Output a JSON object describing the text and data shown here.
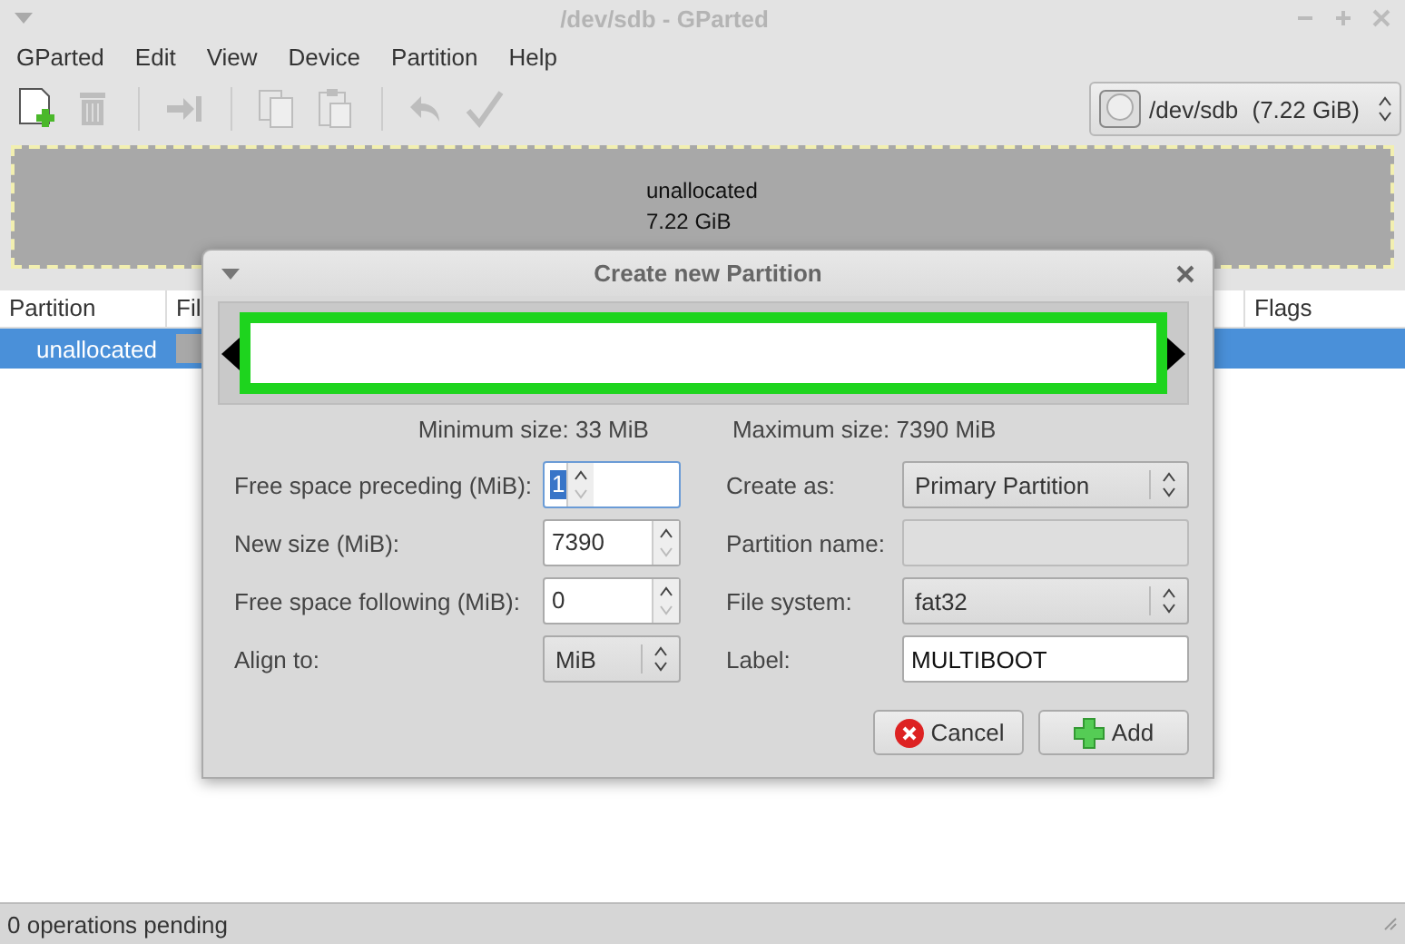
{
  "window": {
    "title": "/dev/sdb - GParted"
  },
  "menu": [
    "GParted",
    "Edit",
    "View",
    "Device",
    "Partition",
    "Help"
  ],
  "toolbar": [
    [
      {
        "kind": "new",
        "disabled": false
      },
      {
        "kind": "delete",
        "disabled": true
      }
    ],
    [
      {
        "kind": "resize",
        "disabled": true
      }
    ],
    [
      {
        "kind": "copy",
        "disabled": true
      },
      {
        "kind": "paste",
        "disabled": true
      }
    ],
    [
      {
        "kind": "undo",
        "disabled": true
      },
      {
        "kind": "apply",
        "disabled": true
      }
    ]
  ],
  "device": {
    "name": "/dev/sdb",
    "size": "(7.22 GiB)"
  },
  "disk_map": {
    "label": "unallocated",
    "size": "7.22 GiB"
  },
  "table": {
    "columns": [
      "Partition",
      "Fil",
      "Flags"
    ],
    "rows": [
      {
        "partition": "unallocated",
        "selected": true
      }
    ]
  },
  "dialog": {
    "title": "Create new Partition",
    "min_size": "Minimum size: 33 MiB",
    "max_size": "Maximum size: 7390 MiB",
    "left_fields": [
      {
        "label": "Free space preceding (MiB):",
        "kind": "spin",
        "value": "1",
        "focused": true
      },
      {
        "label": "New size (MiB):",
        "kind": "spin",
        "value": "7390",
        "focused": false
      },
      {
        "label": "Free space following (MiB):",
        "kind": "spin",
        "value": "0",
        "focused": false
      },
      {
        "label": "Align to:",
        "kind": "combo",
        "value": "MiB",
        "focused": false
      }
    ],
    "right_fields": [
      {
        "label": "Create as:",
        "kind": "combo",
        "value": "Primary Partition",
        "disabled": false
      },
      {
        "label": "Partition name:",
        "kind": "entry",
        "disabled": true
      },
      {
        "label": "File system:",
        "kind": "combo",
        "value": "fat32",
        "disabled": false
      },
      {
        "label": "Label:",
        "kind": "entry",
        "value": "MULTIBOOT",
        "disabled": false
      }
    ],
    "buttons": [
      {
        "kind": "cancel",
        "label": "Cancel"
      },
      {
        "kind": "add",
        "label": "Add"
      }
    ]
  },
  "status_bar": "0 operations pending"
}
